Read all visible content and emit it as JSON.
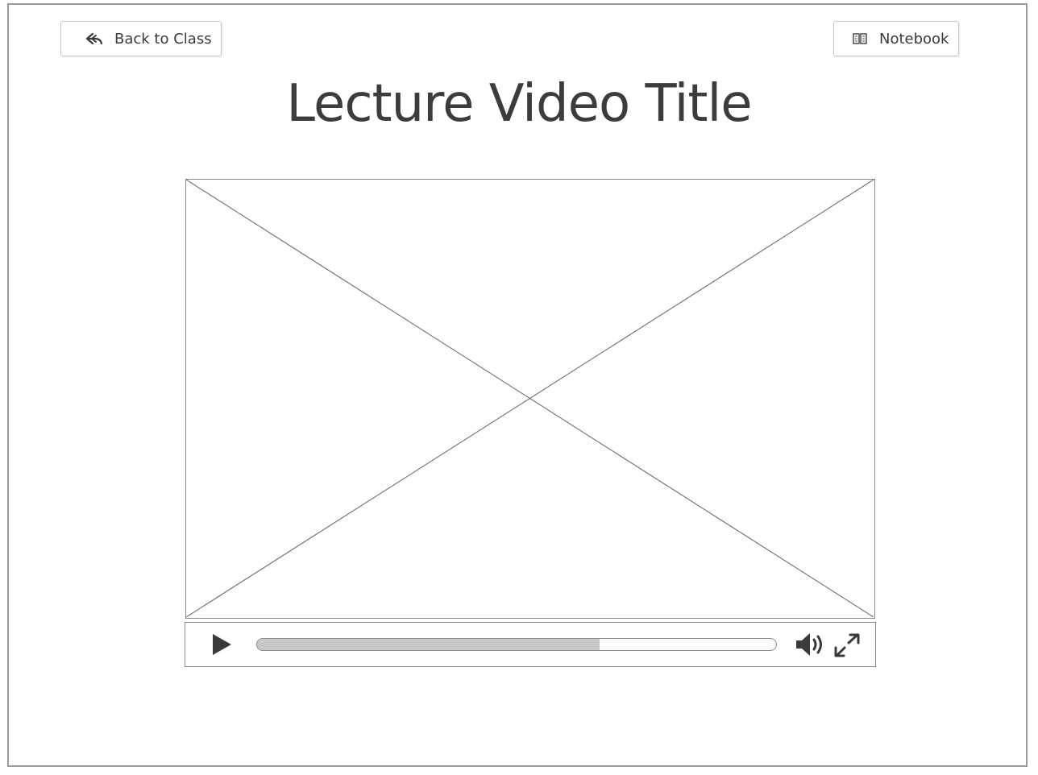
{
  "header": {
    "back_label": "Back to Class",
    "notebook_label": "Notebook",
    "title": "Lecture Video Title"
  },
  "player": {
    "progress_fraction": 0.66,
    "icons": {
      "play": "play-icon",
      "volume": "volume-icon",
      "fullscreen": "fullscreen-icon"
    }
  },
  "icons": {
    "back": "reply-arrow-icon",
    "notebook": "notebook-icon"
  }
}
